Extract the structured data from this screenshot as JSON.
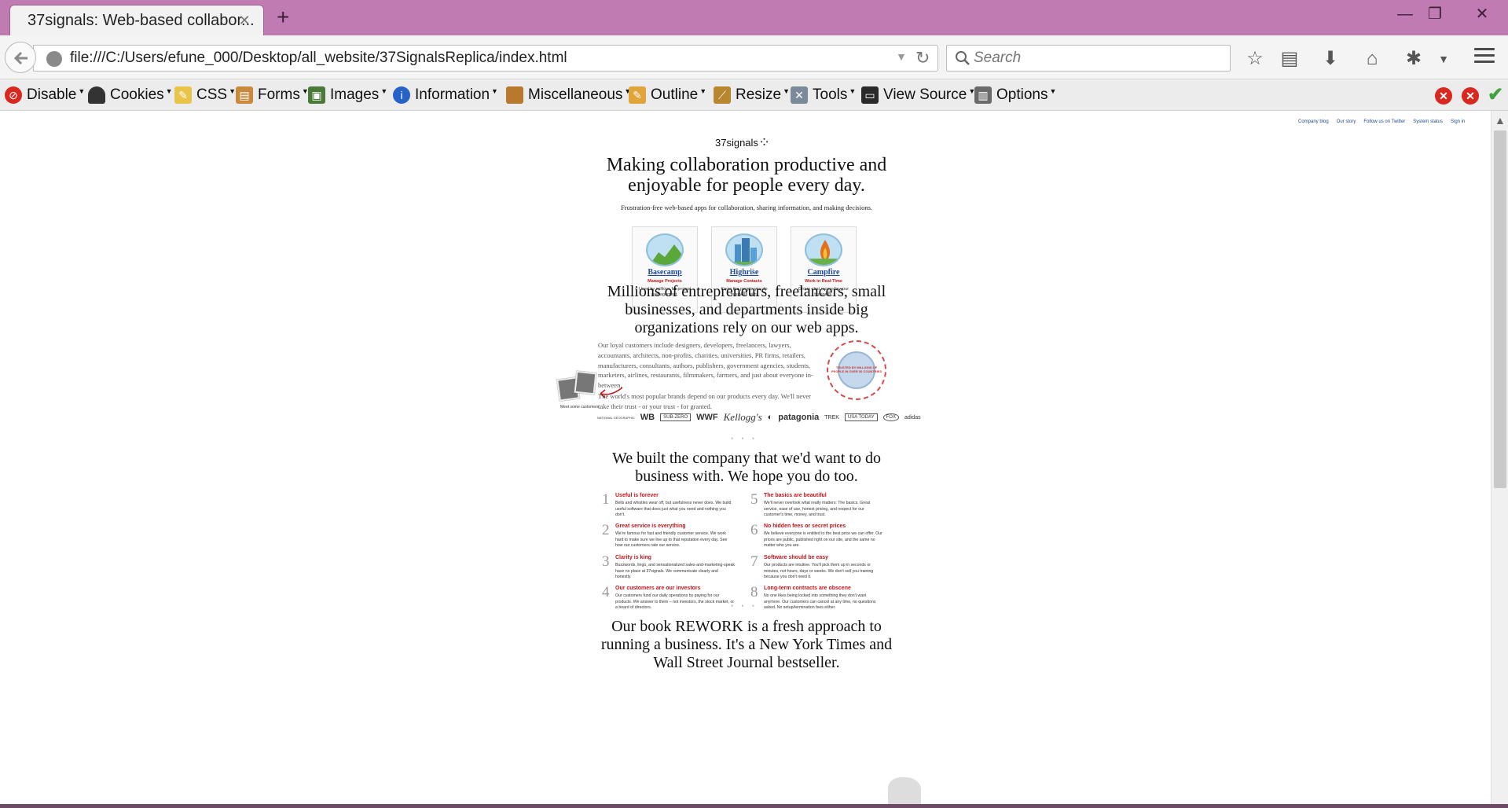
{
  "browser": {
    "tab_title": "37signals: Web-based collabor...",
    "tab_close": "✕",
    "new_tab": "+",
    "url": "file:///C:/Users/efune_000/Desktop/all_website/37SignalsReplica/index.html",
    "search_placeholder": "Search",
    "window_controls": {
      "minimize": "—",
      "maximize": "❐",
      "close": "✕"
    }
  },
  "devtoolbar": {
    "items": [
      "Disable",
      "Cookies",
      "CSS",
      "Forms",
      "Images",
      "Information",
      "Miscellaneous",
      "Outline",
      "Resize",
      "Tools",
      "View Source",
      "Options"
    ],
    "icons": [
      "disable-icon",
      "cookies-icon",
      "css-icon",
      "forms-icon",
      "images-icon",
      "information-icon",
      "miscellaneous-icon",
      "outline-icon",
      "resize-icon",
      "tools-icon",
      "view-source-icon",
      "options-icon"
    ],
    "status": {
      "error1": "✕",
      "error2": "✕",
      "ok": "✔"
    }
  },
  "page": {
    "toplinks": [
      "Company blog",
      "Our story",
      "Follow us on Twitter",
      "System status",
      "Sign in"
    ],
    "logo": "37signals",
    "headline": "Making collaboration productive and enjoyable for people every day.",
    "subheadline": "Frustration-free web-based apps for collaboration, sharing information, and making decisions.",
    "products": [
      {
        "name": "Basecamp",
        "tag": "Manage Projects",
        "desc": "Used by millions for project management.",
        "color": "#5aa83a"
      },
      {
        "name": "Highrise",
        "tag": "Manage Contacts",
        "desc": "Know the people you do business with.",
        "color": "#4a90c8"
      },
      {
        "name": "Campfire",
        "tag": "Work in Real-Time",
        "desc": "Group chat rooms for your business.",
        "color": "#e4701e"
      }
    ],
    "dots": "• • •",
    "section2": {
      "headline": "Millions of entrepreneurs, freelancers, small businesses, and departments inside big organizations rely on our web apps.",
      "photo_caption": "Meet some customers",
      "para1": "Our loyal customers include designers, developers, freelancers, lawyers, accountants, architects, non-profits, charities, universities, PR firms, retailers, manufacturers, consultants, authors, publishers, government agencies, students, marketers, airlines, restaurants, filmmakers, farmers, and just about everyone in-between.",
      "para2": "The world's most popular brands depend on our products every day. We'll never take their trust - or your trust - for granted.",
      "seal_text": "TRUSTED BY MILLIONS OF PEOPLE IN OVER 30 COUNTRIES",
      "brands": [
        "NATIONAL GEOGRAPHIC",
        "WB",
        "SUB-ZERO",
        "WWF",
        "Kellogg's",
        "◐",
        "patagonia",
        "TREK",
        "USA TODAY",
        "FOX",
        "adidas"
      ]
    },
    "section3": {
      "headline": "We built the company that we'd want to do business with. We hope you do too.",
      "values": [
        {
          "num": "1",
          "title": "Useful is forever",
          "desc": "Bells and whistles wear off, but usefulness never does. We build useful software that does just what you need and nothing you don't."
        },
        {
          "num": "2",
          "title": "Great service is everything",
          "desc": "We're famous for fast and friendly customer service. We work hard to make sure we live up to that reputation every day. See how our customers rate our service."
        },
        {
          "num": "3",
          "title": "Clarity is king",
          "desc": "Buzzwords, lingo, and sensationalized sales-and-marketing-speak have no place at 37signals. We communicate clearly and honestly."
        },
        {
          "num": "4",
          "title": "Our customers are our investors",
          "desc": "Our customers fund our daily operations by paying for our products. We answer to them – not investors, the stock market, or a board of directors."
        },
        {
          "num": "5",
          "title": "The basics are beautiful",
          "desc": "We'll never overlook what really matters: The basics. Great service, ease of use, honest pricing, and respect for our customer's time, money, and trust."
        },
        {
          "num": "6",
          "title": "No hidden fees or secret prices",
          "desc": "We believe everyone is entitled to the best price we can offer. Our prices are public, published right on our site, and the same no matter who you are."
        },
        {
          "num": "7",
          "title": "Software should be easy",
          "desc": "Our products are intuitive. You'll pick them up in seconds or minutes, not hours, days or weeks. We don't sell you training because you don't need it."
        },
        {
          "num": "8",
          "title": "Long-term contracts are obscene",
          "desc": "No one likes being locked into something they don't want anymore. Our customers can cancel at any time, no questions asked. No setup/termination fees either."
        }
      ]
    },
    "section4": {
      "headline": "Our book REWORK is a fresh approach to running a business. It's a New York Times and Wall Street Journal bestseller."
    }
  }
}
